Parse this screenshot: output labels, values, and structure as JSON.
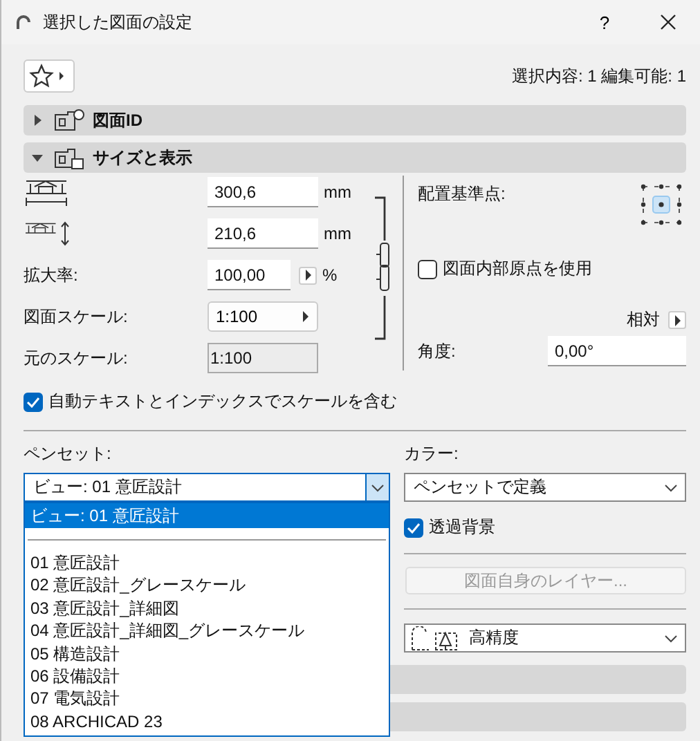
{
  "window": {
    "title": "選択した図面の設定",
    "help": "?"
  },
  "selection_info": "選択内容: 1 編集可能: 1",
  "sections": [
    {
      "label": "図面ID",
      "expanded": false
    },
    {
      "label": "サイズと表示",
      "expanded": true
    }
  ],
  "size": {
    "width": {
      "value": "300,6",
      "unit": "mm"
    },
    "height": {
      "value": "210,6",
      "unit": "mm"
    },
    "magnification": {
      "label": "拡大率:",
      "value": "100,00",
      "unit": "%"
    },
    "drawing_scale": {
      "label": "図面スケール:",
      "value": "1:100"
    },
    "original_scale": {
      "label": "元のスケール:",
      "value": "1:100"
    }
  },
  "anchor": {
    "label": "配置基準点:"
  },
  "use_origin": {
    "label": "図面内部原点を使用",
    "checked": false
  },
  "relative": "相対",
  "angle": {
    "label": "角度:",
    "value": "0,00°"
  },
  "include_scale": {
    "label": "自動テキストとインデックスでスケールを含む",
    "checked": true
  },
  "pen_set": {
    "label": "ペンセット:",
    "value": "ビュー: 01 意匠設計",
    "open": true,
    "options": [
      {
        "kind": "option",
        "label": "ビュー: 01 意匠設計",
        "selected": true
      },
      {
        "kind": "separator"
      },
      {
        "kind": "option",
        "label": "01 意匠設計",
        "selected": false
      },
      {
        "kind": "option",
        "label": "02 意匠設計_グレースケール",
        "selected": false
      },
      {
        "kind": "option",
        "label": "03 意匠設計_詳細図",
        "selected": false
      },
      {
        "kind": "option",
        "label": "04 意匠設計_詳細図_グレースケール",
        "selected": false
      },
      {
        "kind": "option",
        "label": "05 構造設計",
        "selected": false
      },
      {
        "kind": "option",
        "label": "06 設備設計",
        "selected": false
      },
      {
        "kind": "option",
        "label": "07 電気設計",
        "selected": false
      },
      {
        "kind": "option",
        "label": "08 ARCHICAD 23",
        "selected": false
      }
    ]
  },
  "color": {
    "label": "カラー:",
    "value": "ペンセットで定義"
  },
  "transparent_background": {
    "label": "透過背景",
    "checked": true
  },
  "own_layers_button": {
    "label": "図面自身のレイヤー...",
    "disabled": true
  },
  "quality": {
    "value": "高精度"
  }
}
